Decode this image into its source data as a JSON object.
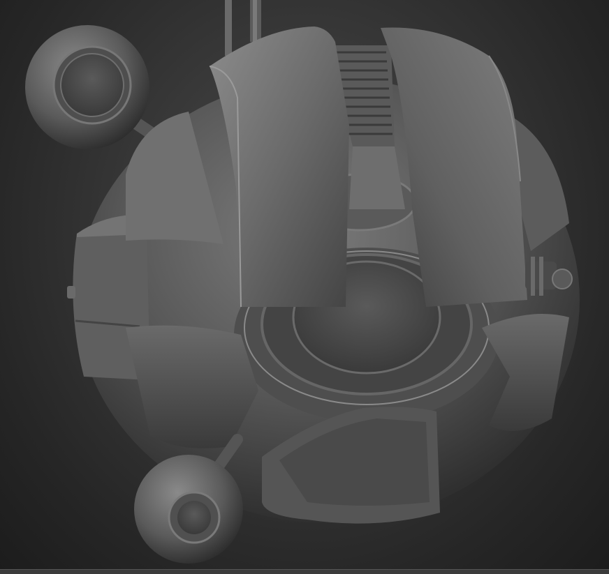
{
  "scene": {
    "subject": "robot-drone-sculpt",
    "render_style": "matcap-gray",
    "colors": {
      "background_center": "#4a4a4a",
      "background_edge": "#1c1c1c",
      "surface_light": "#8a8a8a",
      "surface_mid": "#5e5e5e",
      "surface_dark": "#2e2e2e"
    }
  }
}
